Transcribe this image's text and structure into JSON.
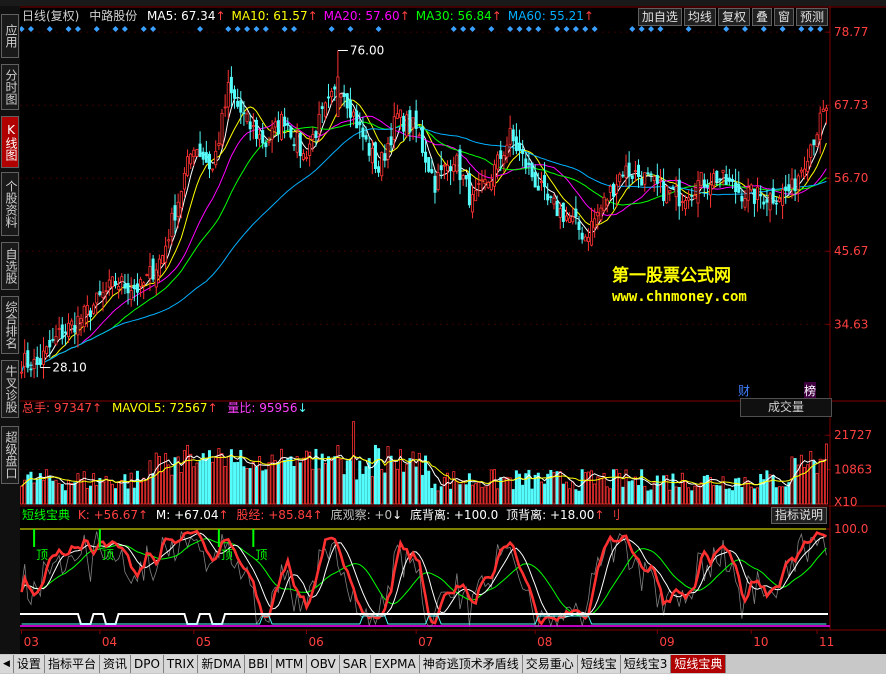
{
  "sidebar": {
    "tabs": [
      {
        "label": "应用",
        "active": false
      },
      {
        "label": "分时图",
        "active": false
      },
      {
        "label": "K线图",
        "active": true
      },
      {
        "label": "个股资料",
        "active": false
      },
      {
        "label": "自选股",
        "active": false
      },
      {
        "label": "综合排名",
        "active": false
      },
      {
        "label": "牛叉诊股",
        "active": false
      },
      {
        "label": "超级盘口",
        "active": false
      }
    ]
  },
  "header": {
    "period": "日线(复权)",
    "stock_name": "中路股份",
    "ma": [
      {
        "label": "MA5: 67.34",
        "color": "#ffffff"
      },
      {
        "label": "MA10: 61.57",
        "color": "#ffff00"
      },
      {
        "label": "MA20: 57.60",
        "color": "#ff00ff"
      },
      {
        "label": "MA30: 56.84",
        "color": "#00ff00"
      },
      {
        "label": "MA60: 55.21",
        "color": "#00b0ff"
      }
    ]
  },
  "toolbar": {
    "buttons": [
      "加自选",
      "均线",
      "复权",
      "叠",
      "窗",
      "预测"
    ]
  },
  "watermark": {
    "line1": "第一股票公式网",
    "line2": "www.chnmoney.com"
  },
  "price_panel": {
    "high_label": "76.00",
    "low_label": "28.10",
    "tag_finance": "财",
    "tag_rank": "榜"
  },
  "volume_panel": {
    "title_button": "成交量",
    "total_hands": "总手: 97347",
    "mavol5": "MAVOL5: 72567",
    "ratio": "量比: 95956",
    "axis_unit": "X10"
  },
  "indicator_panel": {
    "name": "短线宝典",
    "k": "K: +56.67",
    "m": "M: +67.04",
    "stock_trade": "股经: +85.84",
    "bottom_watch": "底观察: +0",
    "bottom_divergence": "底背离: +100.0",
    "top_divergence": "顶背离: +18.00",
    "help_button": "指标说明",
    "top_marker": "顶"
  },
  "bottom_tabs": [
    {
      "label": "设置",
      "active": false
    },
    {
      "label": "指标平台",
      "active": false
    },
    {
      "label": "资讯",
      "active": false
    },
    {
      "label": "DPO",
      "active": false
    },
    {
      "label": "TRIX",
      "active": false
    },
    {
      "label": "新DMA",
      "active": false
    },
    {
      "label": "BBI",
      "active": false
    },
    {
      "label": "MTM",
      "active": false
    },
    {
      "label": "OBV",
      "active": false
    },
    {
      "label": "SAR",
      "active": false
    },
    {
      "label": "EXPMA",
      "active": false
    },
    {
      "label": "神奇逃顶术矛盾线",
      "active": false
    },
    {
      "label": "交易重心",
      "active": false
    },
    {
      "label": "短线宝",
      "active": false
    },
    {
      "label": "短线宝3",
      "active": false
    },
    {
      "label": "短线宝典",
      "active": true
    }
  ],
  "colors": {
    "up": "#ff3232",
    "down": "#54fcfc",
    "grid": "#800000",
    "axis_text": "#ff4040",
    "kline": "#ff3030",
    "mline": "#ffffff",
    "green_line": "#00ff00"
  },
  "chart_data": [
    {
      "type": "candlestick",
      "title": "日线(复权) 中路股份",
      "x_ticks": [
        "03",
        "04",
        "05",
        "06",
        "07",
        "08",
        "09",
        "10",
        "11"
      ],
      "y_ticks": [
        34.63,
        45.67,
        56.7,
        67.73,
        78.77
      ],
      "ylim": [
        23.5,
        80.0
      ],
      "anchors": [
        {
          "i": 0,
          "close": 29
        },
        {
          "i": 5,
          "close": 28.5
        },
        {
          "i": 12,
          "close": 33
        },
        {
          "i": 20,
          "close": 36
        },
        {
          "i": 30,
          "close": 41
        },
        {
          "i": 38,
          "close": 40
        },
        {
          "i": 45,
          "close": 45
        },
        {
          "i": 55,
          "close": 62
        },
        {
          "i": 61,
          "close": 58
        },
        {
          "i": 66,
          "close": 70
        },
        {
          "i": 72,
          "close": 65
        },
        {
          "i": 78,
          "close": 62
        },
        {
          "i": 84,
          "close": 66
        },
        {
          "i": 90,
          "close": 60
        },
        {
          "i": 96,
          "close": 66
        },
        {
          "i": 102,
          "close": 71
        },
        {
          "i": 108,
          "close": 64
        },
        {
          "i": 114,
          "close": 58
        },
        {
          "i": 120,
          "close": 66
        },
        {
          "i": 126,
          "close": 64
        },
        {
          "i": 132,
          "close": 56
        },
        {
          "i": 138,
          "close": 60
        },
        {
          "i": 144,
          "close": 53
        },
        {
          "i": 150,
          "close": 57
        },
        {
          "i": 156,
          "close": 63
        },
        {
          "i": 162,
          "close": 58
        },
        {
          "i": 168,
          "close": 53
        },
        {
          "i": 174,
          "close": 51
        },
        {
          "i": 180,
          "close": 48
        },
        {
          "i": 186,
          "close": 53
        },
        {
          "i": 192,
          "close": 58
        },
        {
          "i": 198,
          "close": 57
        },
        {
          "i": 204,
          "close": 55
        },
        {
          "i": 210,
          "close": 54
        },
        {
          "i": 216,
          "close": 56
        },
        {
          "i": 222,
          "close": 57
        },
        {
          "i": 228,
          "close": 55
        },
        {
          "i": 234,
          "close": 54
        },
        {
          "i": 240,
          "close": 54
        },
        {
          "i": 246,
          "close": 55
        },
        {
          "i": 252,
          "close": 62
        },
        {
          "i": 257,
          "close": 67.3
        }
      ],
      "count": 258,
      "high": 76.0,
      "low": 28.1
    },
    {
      "type": "bar",
      "title": "成交量",
      "y_ticks": [
        10863,
        21727
      ],
      "unit": "X10",
      "last_value": 97347
    },
    {
      "type": "line",
      "title": "短线宝典",
      "y_ticks": [
        100.0
      ],
      "series": [
        {
          "name": "K",
          "last": 56.67
        },
        {
          "name": "M",
          "last": 67.04
        }
      ]
    }
  ]
}
